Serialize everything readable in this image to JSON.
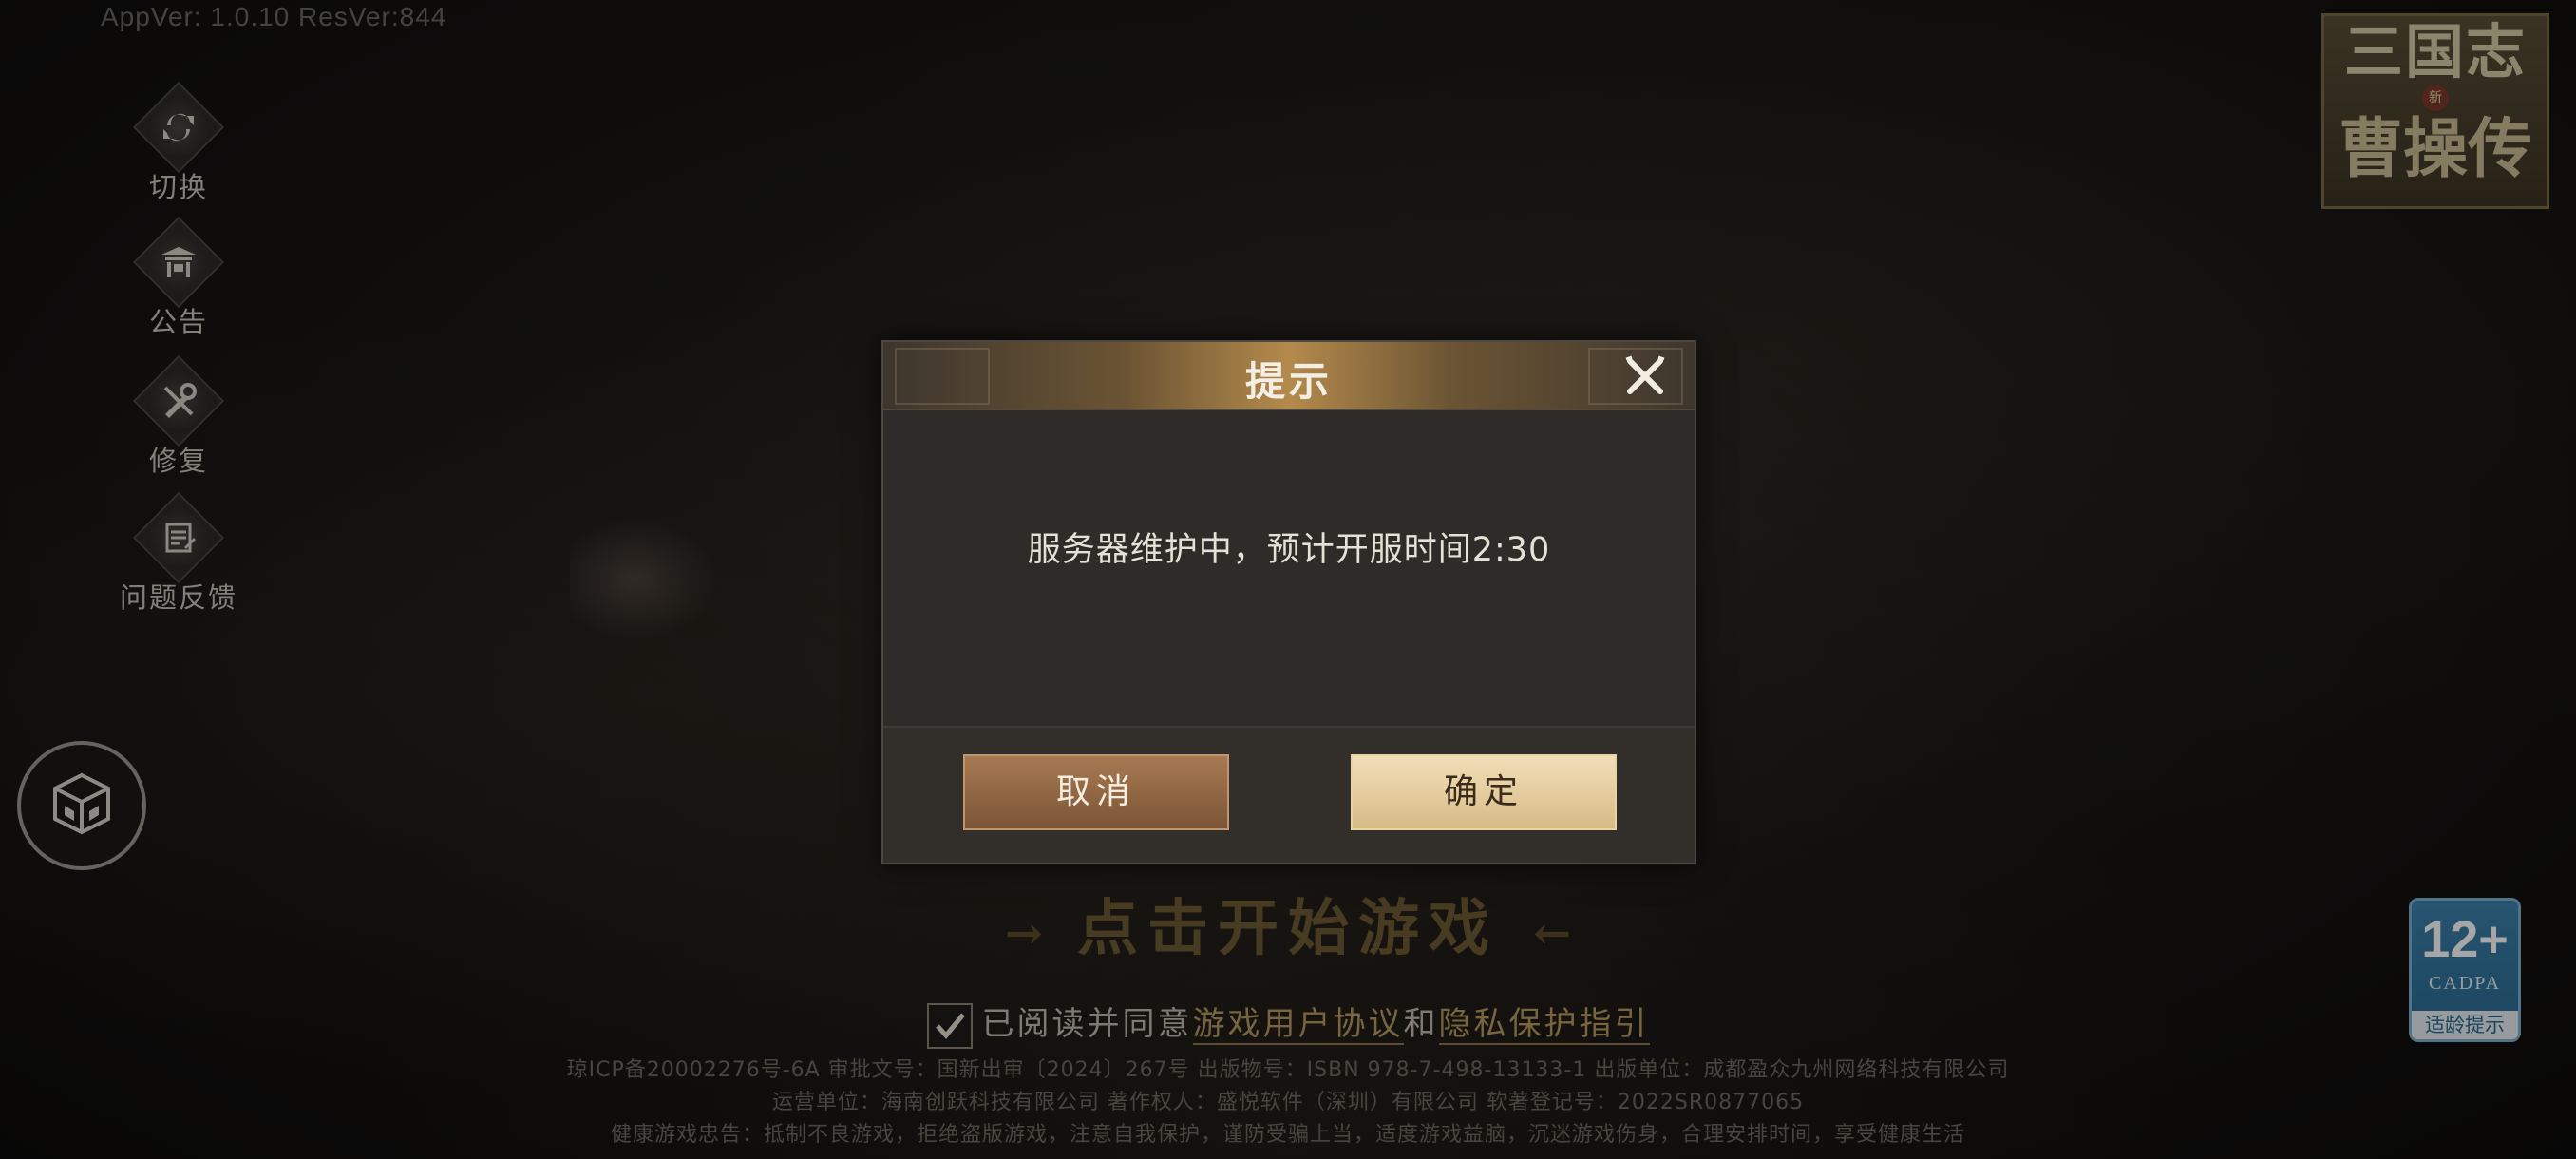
{
  "version": "AppVer: 1.0.10 ResVer:844",
  "side_menu": [
    {
      "label": "切换",
      "icon": "refresh-icon"
    },
    {
      "label": "公告",
      "icon": "pavilion-icon"
    },
    {
      "label": "修复",
      "icon": "wrench-icon"
    },
    {
      "label": "问题反馈",
      "icon": "feedback-icon"
    }
  ],
  "cube_button_icon": "cube-icon",
  "logo": {
    "top": "三国志",
    "mid": "新",
    "bottom": "曹操传"
  },
  "age_badge": {
    "rating": "12+",
    "org": "CADPA",
    "tip": "适龄提示"
  },
  "start_game": {
    "label": "点击开始游戏",
    "arrow_left": "→",
    "arrow_right": "←"
  },
  "agreement": {
    "checked": true,
    "prefix": "已阅读并同意",
    "user_agreement": "游戏用户协议",
    "and": "和",
    "privacy": "隐私保护指引"
  },
  "legal_lines": [
    "琼ICP备20002276号-6A  审批文号：国新出审〔2024〕267号  出版物号：ISBN 978-7-498-13133-1  出版单位：成都盈众九州网络科技有限公司",
    "运营单位：海南创跃科技有限公司  著作权人：盛悦软件（深圳）有限公司  软著登记号：2022SR0877065",
    "健康游戏忠告：抵制不良游戏，拒绝盗版游戏，注意自我保护，谨防受骗上当，适度游戏益脑，沉迷游戏伤身，合理安排时间，享受健康生活"
  ],
  "dialog": {
    "title": "提示",
    "message": "服务器维护中，预计开服时间2:30",
    "cancel_label": "取消",
    "ok_label": "确定",
    "close_icon": "close-icon"
  }
}
